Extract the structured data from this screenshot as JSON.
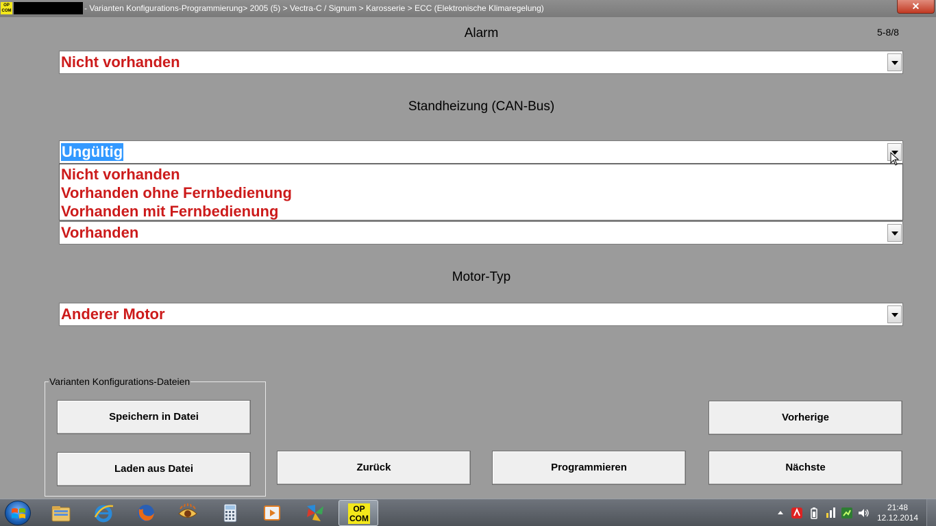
{
  "window": {
    "logo_text_line1": "OP",
    "logo_text_line2": "COM",
    "title": "- Varianten Konfigurations-Programmierung> 2005 (5) > Vectra-C / Signum > Karosserie > ECC (Elektronische Klimaregelung)",
    "close_label": "✕"
  },
  "page_indicator": "5-8/8",
  "fields": [
    {
      "label": "Alarm",
      "value": "Nicht vorhanden"
    },
    {
      "label": "Standheizung (CAN-Bus)",
      "value": "Ungültig",
      "options": [
        "Nicht vorhanden",
        "Vorhanden ohne Fernbedienung",
        "Vorhanden mit Fernbedienung"
      ]
    },
    {
      "label": "",
      "value": "Vorhanden"
    },
    {
      "label": "Motor-Typ",
      "value": "Anderer Motor"
    }
  ],
  "file_group": {
    "title": "Varianten Konfigurations-Dateien",
    "save_label": "Speichern in Datei",
    "load_label": "Laden aus Datei"
  },
  "buttons": {
    "back": "Zurück",
    "program": "Programmieren",
    "previous": "Vorherige",
    "next": "Nächste"
  },
  "taskbar": {
    "active_app_line1": "OP",
    "active_app_line2": "COM",
    "icons": [
      "explorer-icon",
      "internet-explorer-icon",
      "firefox-icon",
      "eye-app-icon",
      "calculator-icon",
      "media-player-icon",
      "pinwheel-app-icon"
    ],
    "time": "21:48",
    "date": "12.12.2014"
  },
  "colors": {
    "value_text": "#cc1b1b",
    "selection": "#3399ff",
    "background": "#9b9b9b"
  }
}
